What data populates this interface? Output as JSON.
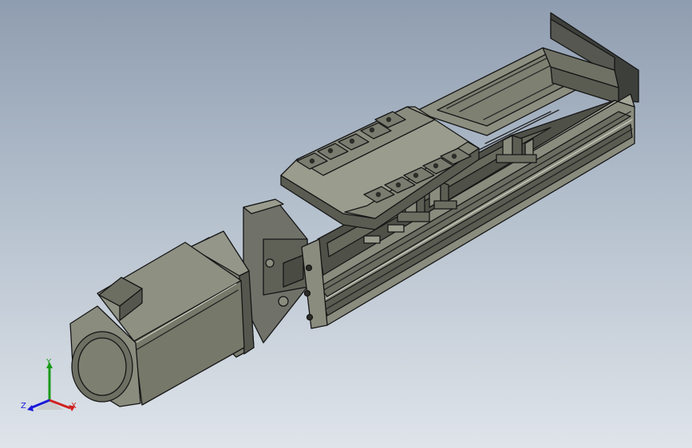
{
  "viewport": {
    "background_top": "#8f9db0",
    "background_bottom": "#dfe4ea",
    "model": {
      "name": "linear-actuator-with-servo-motor",
      "body_color": "#7b7d6f",
      "edge_color": "#151515"
    }
  },
  "triad": {
    "x_label": "X",
    "y_label": "Y",
    "z_label": "Z",
    "x_color": "#d02020",
    "y_color": "#1a9a1a",
    "z_color": "#1a1ad8"
  }
}
